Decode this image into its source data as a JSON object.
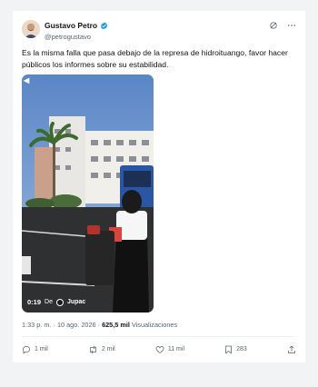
{
  "author": {
    "display_name": "Gustavo Petro",
    "handle": "@petrogustavo",
    "verified": true
  },
  "header_icons": [
    "grok-icon",
    "more-icon"
  ],
  "tweet": {
    "text": "Es la misma falla que pasa debajo de la represa de hidroituango, favor hacer públicos los informes sobre su estabilidad."
  },
  "video": {
    "duration": "0:19",
    "from_label": "De",
    "source": "Jupac"
  },
  "meta": {
    "time": "1:33 p. m.",
    "separator": " · ",
    "date": "10 ago. 2026",
    "views": "625,5 mil",
    "views_label": "Visualizaciones"
  },
  "actions": {
    "replies": "1 mil",
    "reposts": "2 mil",
    "likes": "11 mil",
    "bookmarks": "283"
  },
  "colors": {
    "text": "#0f1419",
    "secondary": "#536471",
    "verified": "#1d9bf0",
    "background": "#f2f3f4"
  }
}
